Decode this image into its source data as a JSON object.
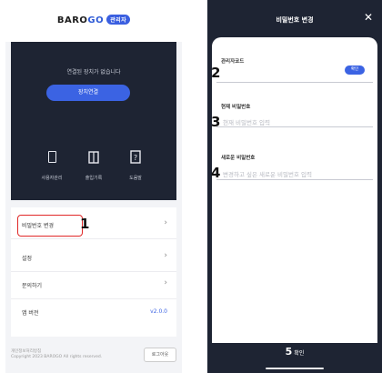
{
  "left_screen": {
    "brand": {
      "main": "BARO",
      "accent": "GO",
      "badge": "관리자"
    },
    "notice": "연결된 장치가 없습니다",
    "bind_button": "장치연결",
    "quick_actions": [
      {
        "icon": "tablet-icon",
        "label": "사용자관리"
      },
      {
        "icon": "door-icon",
        "label": "출입기록"
      },
      {
        "icon": "help-icon",
        "label": "도움말"
      }
    ],
    "menu": [
      {
        "label": "비밀번호 변경",
        "chevron": "›",
        "callout": "1"
      },
      {
        "label": "설정",
        "chevron": "›"
      },
      {
        "label": "문의하기",
        "chevron": "›"
      },
      {
        "label": "앱 버전",
        "version": "v2.0.0"
      }
    ],
    "footer": {
      "line1": "개인정보처리방침",
      "line2": "Copyright 2023 BAROGO All rights reserved.",
      "logout": "로그아웃"
    }
  },
  "right_screen": {
    "title": "비밀번호 변경",
    "close": "✕",
    "fields": [
      {
        "label": "관리자코드",
        "placeholder": "",
        "callout": "2",
        "button": "확인"
      },
      {
        "label": "현재 비밀번호",
        "placeholder": "현재 비밀번호 입력",
        "callout": "3"
      },
      {
        "label": "새로운 비밀번호",
        "placeholder": "변경하고 싶은 새로운 비밀번호 입력",
        "callout": "4"
      }
    ],
    "bottom_button": {
      "callout": "5",
      "label": "확인"
    }
  },
  "colors": {
    "primary": "#3b63e3",
    "dark_bg": "#1e2433",
    "highlight": "#e02828"
  }
}
